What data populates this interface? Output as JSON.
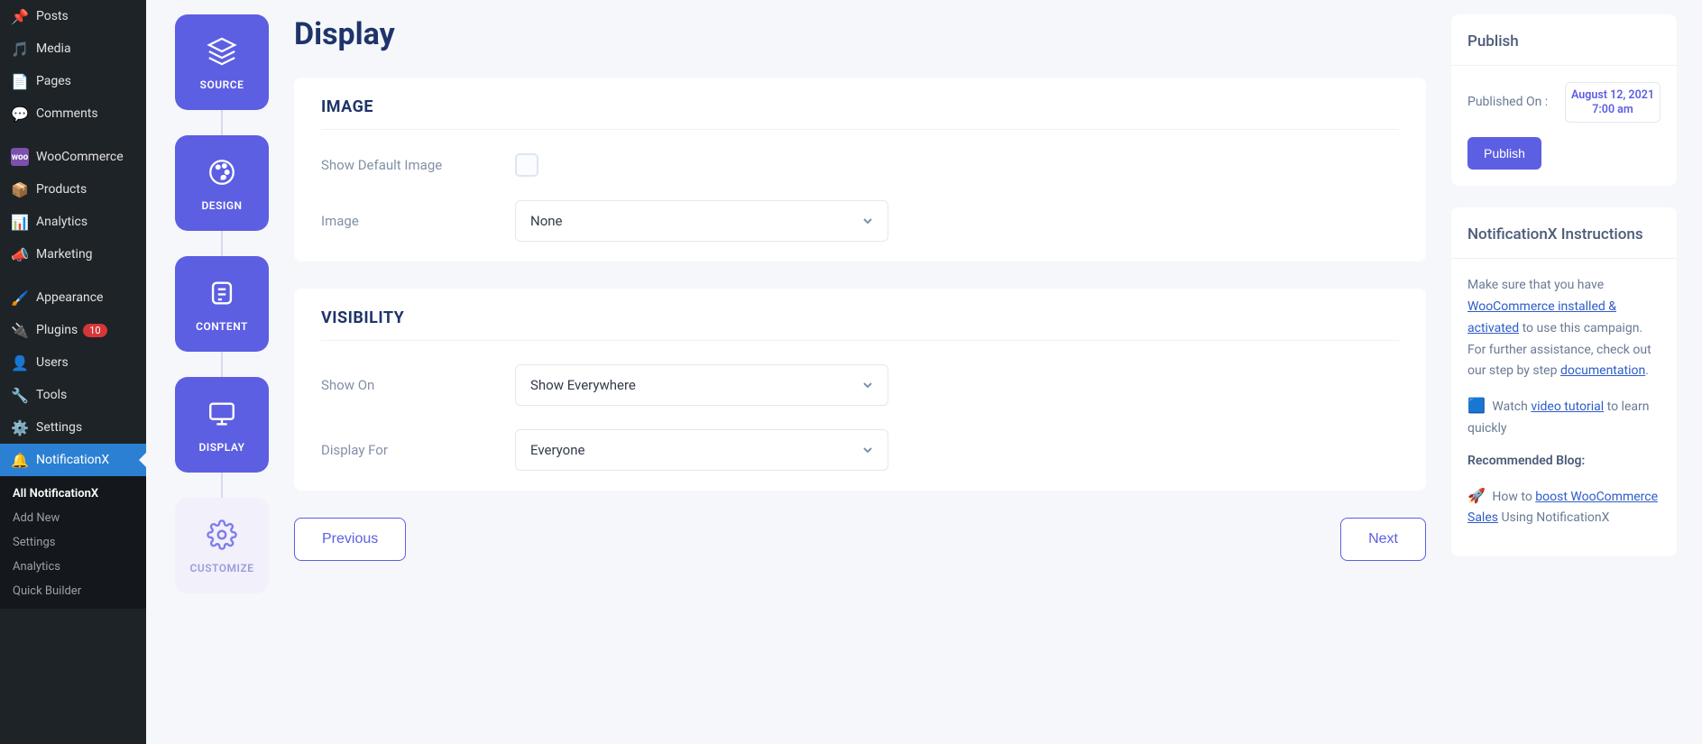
{
  "wp_menu": {
    "posts": "Posts",
    "media": "Media",
    "pages": "Pages",
    "comments": "Comments",
    "woocommerce": "WooCommerce",
    "products": "Products",
    "analytics": "Analytics",
    "marketing": "Marketing",
    "appearance": "Appearance",
    "plugins": "Plugins",
    "plugins_badge": "10",
    "users": "Users",
    "tools": "Tools",
    "settings": "Settings",
    "notificationx": "NotificationX",
    "submenu": {
      "all": "All NotificationX",
      "add_new": "Add New",
      "settings": "Settings",
      "analytics": "Analytics",
      "quick_builder": "Quick Builder"
    }
  },
  "steps": {
    "source": "SOURCE",
    "design": "DESIGN",
    "content": "CONTENT",
    "display": "DISPLAY",
    "customize": "CUSTOMIZE"
  },
  "page": {
    "title": "Display",
    "image_section": {
      "title": "IMAGE",
      "show_default_label": "Show Default Image",
      "image_label": "Image",
      "image_value": "None"
    },
    "visibility_section": {
      "title": "VISIBILITY",
      "show_on_label": "Show On",
      "show_on_value": "Show Everywhere",
      "display_for_label": "Display For",
      "display_for_value": "Everyone"
    },
    "previous": "Previous",
    "next": "Next"
  },
  "right": {
    "publish_title": "Publish",
    "published_on_label": "Published On :",
    "published_date": "August 12, 2021",
    "published_time": "7:00 am",
    "publish_button": "Publish",
    "instructions_title": "NotificationX Instructions",
    "instructions": {
      "line1_a": "Make sure that you have ",
      "link_woo": "WooCommerce installed & activated",
      "line1_b": " to use this campaign. For further assistance, check out our step by step ",
      "link_doc": "documentation",
      "period": ".",
      "video_a": "Watch ",
      "link_video": "video tutorial",
      "video_b": " to learn quickly",
      "rec_title": "Recommended Blog:",
      "howto_a": "How to ",
      "link_blog": "boost WooCommerce Sales",
      "howto_b": " Using NotificationX"
    }
  }
}
